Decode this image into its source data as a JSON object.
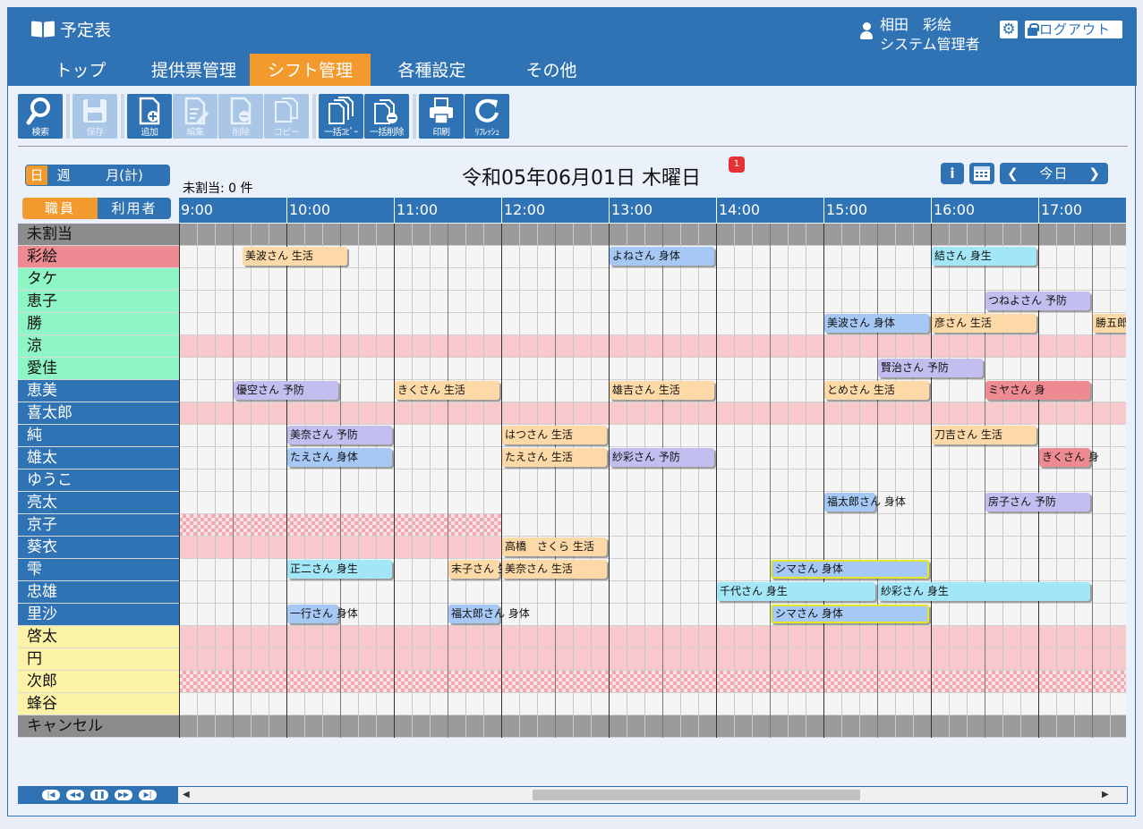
{
  "header": {
    "app_title": "予定表",
    "user_name": "相田　彩絵",
    "user_role": "システム管理者",
    "logout_label": "ログアウト",
    "menu": [
      "トップ",
      "提供票管理",
      "シフト管理",
      "各種設定",
      "その他"
    ]
  },
  "toolbar": {
    "search": "検索",
    "save": "保存",
    "add": "追加",
    "edit": "編集",
    "delete": "削除",
    "copy": "コピー",
    "bulk_copy": "一括ｺﾋﾟｰ",
    "bulk_delete": "一括削除",
    "print": "印刷",
    "refresh": "ﾘﾌﾚｯｼｭ"
  },
  "view": {
    "mode_tabs": [
      "日",
      "週",
      "月(計)"
    ],
    "type_tabs": [
      "職員",
      "利用者"
    ],
    "unassigned_text": "未割当: 0 件",
    "date_title": "令和05年06月01日 木曜日",
    "notice_count": "1",
    "today_label": "今日",
    "info_label": "i"
  },
  "timeline": {
    "hours": [
      "9:00",
      "10:00",
      "11:00",
      "12:00",
      "13:00",
      "14:00",
      "15:00",
      "16:00",
      "17:00"
    ],
    "colors": {
      "header": "#2f73b5",
      "active": "#f39a2e"
    }
  },
  "staff": [
    {
      "name": "未割当",
      "color": "#8c8c8c",
      "text": "#111",
      "row": "gray"
    },
    {
      "name": "彩絵",
      "color": "#ee8a92",
      "text": "#111",
      "row": ""
    },
    {
      "name": "タケ",
      "color": "#8ef5c4",
      "text": "#111",
      "row": ""
    },
    {
      "name": "恵子",
      "color": "#8ef5c4",
      "text": "#111",
      "row": ""
    },
    {
      "name": "勝",
      "color": "#8ef5c4",
      "text": "#111",
      "row": ""
    },
    {
      "name": "涼",
      "color": "#8ef5c4",
      "text": "#111",
      "row": "pink"
    },
    {
      "name": "愛佳",
      "color": "#8ef5c4",
      "text": "#111",
      "row": ""
    },
    {
      "name": "恵美",
      "color": "#2f73b5",
      "text": "#fff",
      "row": ""
    },
    {
      "name": "喜太郎",
      "color": "#2f73b5",
      "text": "#fff",
      "row": "pink"
    },
    {
      "name": "純",
      "color": "#2f73b5",
      "text": "#fff",
      "row": ""
    },
    {
      "name": "雄太",
      "color": "#2f73b5",
      "text": "#fff",
      "row": ""
    },
    {
      "name": "ゆうこ",
      "color": "#2f73b5",
      "text": "#fff",
      "row": ""
    },
    {
      "name": "亮太",
      "color": "#2f73b5",
      "text": "#fff",
      "row": ""
    },
    {
      "name": "京子",
      "color": "#2f73b5",
      "text": "#fff",
      "row": "check-half"
    },
    {
      "name": "葵衣",
      "color": "#2f73b5",
      "text": "#fff",
      "row": "pink-half"
    },
    {
      "name": "雫",
      "color": "#2f73b5",
      "text": "#fff",
      "row": ""
    },
    {
      "name": "忠雄",
      "color": "#2f73b5",
      "text": "#fff",
      "row": ""
    },
    {
      "name": "里沙",
      "color": "#2f73b5",
      "text": "#fff",
      "row": ""
    },
    {
      "name": "啓太",
      "color": "#fdf3a8",
      "text": "#111",
      "row": "pink"
    },
    {
      "name": "円",
      "color": "#fdf3a8",
      "text": "#111",
      "row": "pink"
    },
    {
      "name": "次郎",
      "color": "#fdf3a8",
      "text": "#111",
      "row": "check"
    },
    {
      "name": "蜂谷",
      "color": "#fdf3a8",
      "text": "#111",
      "row": ""
    },
    {
      "name": "キャンセル",
      "color": "#8c8c8c",
      "text": "#111",
      "row": "gray"
    }
  ],
  "events": [
    {
      "row": 1,
      "start": "09:35",
      "end": "10:35",
      "label": "美波さん 生活",
      "type": "t-life"
    },
    {
      "row": 1,
      "start": "13:00",
      "end": "14:00",
      "label": "よねさん 身体",
      "type": "t-body"
    },
    {
      "row": 1,
      "start": "16:00",
      "end": "17:00",
      "label": "結さん 身生",
      "type": "t-cyan"
    },
    {
      "row": 3,
      "start": "16:30",
      "end": "17:30",
      "label": "つねよさん 予防",
      "type": "t-prev"
    },
    {
      "row": 4,
      "start": "15:00",
      "end": "16:00",
      "label": "美波さん 身体",
      "type": "t-body"
    },
    {
      "row": 4,
      "start": "16:00",
      "end": "17:00",
      "label": "彦さん 生活",
      "type": "t-life"
    },
    {
      "row": 4,
      "start": "17:30",
      "end": "18:30",
      "label": "勝五郎",
      "type": "t-life"
    },
    {
      "row": 6,
      "start": "15:30",
      "end": "16:30",
      "label": "賢治さん 予防",
      "type": "t-prev"
    },
    {
      "row": 7,
      "start": "09:30",
      "end": "10:30",
      "label": "優空さん 予防",
      "type": "t-prev"
    },
    {
      "row": 7,
      "start": "11:00",
      "end": "12:00",
      "label": "きくさん 生活",
      "type": "t-life"
    },
    {
      "row": 7,
      "start": "13:00",
      "end": "14:00",
      "label": "雄吉さん 生活",
      "type": "t-life"
    },
    {
      "row": 7,
      "start": "15:00",
      "end": "16:00",
      "label": "とめさん 生活",
      "type": "t-life"
    },
    {
      "row": 7,
      "start": "16:30",
      "end": "17:30",
      "label": "ミヤさん 身",
      "type": "t-red"
    },
    {
      "row": 9,
      "start": "10:00",
      "end": "11:00",
      "label": "美奈さん 予防",
      "type": "t-prev"
    },
    {
      "row": 9,
      "start": "12:00",
      "end": "13:00",
      "label": "はつさん 生活",
      "type": "t-life"
    },
    {
      "row": 9,
      "start": "16:00",
      "end": "17:00",
      "label": "刀吉さん 生活",
      "type": "t-life"
    },
    {
      "row": 10,
      "start": "10:00",
      "end": "11:00",
      "label": "たえさん 身体",
      "type": "t-body"
    },
    {
      "row": 10,
      "start": "12:00",
      "end": "13:00",
      "label": "たえさん 生活",
      "type": "t-life"
    },
    {
      "row": 10,
      "start": "13:00",
      "end": "14:00",
      "label": "紗彩さん 予防",
      "type": "t-prev"
    },
    {
      "row": 10,
      "start": "17:00",
      "end": "17:30",
      "label": "きくさん 身",
      "type": "t-red"
    },
    {
      "row": 12,
      "start": "15:00",
      "end": "15:30",
      "label": "福太郎さん 身体",
      "type": "t-body"
    },
    {
      "row": 12,
      "start": "16:30",
      "end": "17:30",
      "label": "房子さん 予防",
      "type": "t-prev"
    },
    {
      "row": 14,
      "start": "12:00",
      "end": "13:00",
      "label": "高橋　さくら 生活",
      "type": "t-life"
    },
    {
      "row": 15,
      "start": "10:00",
      "end": "11:00",
      "label": "正二さん 身生",
      "type": "t-cyan"
    },
    {
      "row": 15,
      "start": "11:30",
      "end": "12:00",
      "label": "末子さん 生活",
      "type": "t-life"
    },
    {
      "row": 15,
      "start": "12:00",
      "end": "13:00",
      "label": "美奈さん 生活",
      "type": "t-life"
    },
    {
      "row": 15,
      "start": "14:30",
      "end": "16:00",
      "label": "シマさん 身体",
      "type": "t-body",
      "sel": true
    },
    {
      "row": 16,
      "start": "14:00",
      "end": "15:30",
      "label": "千代さん 身生",
      "type": "t-cyan"
    },
    {
      "row": 16,
      "start": "15:30",
      "end": "17:30",
      "label": "紗彩さん 身生",
      "type": "t-cyan"
    },
    {
      "row": 17,
      "start": "10:00",
      "end": "10:30",
      "label": "一行さん 身体",
      "type": "t-body"
    },
    {
      "row": 17,
      "start": "11:30",
      "end": "12:00",
      "label": "福太郎さん 身体",
      "type": "t-body"
    },
    {
      "row": 17,
      "start": "14:30",
      "end": "16:00",
      "label": "シマさん 身体",
      "type": "t-body",
      "sel": true
    }
  ]
}
